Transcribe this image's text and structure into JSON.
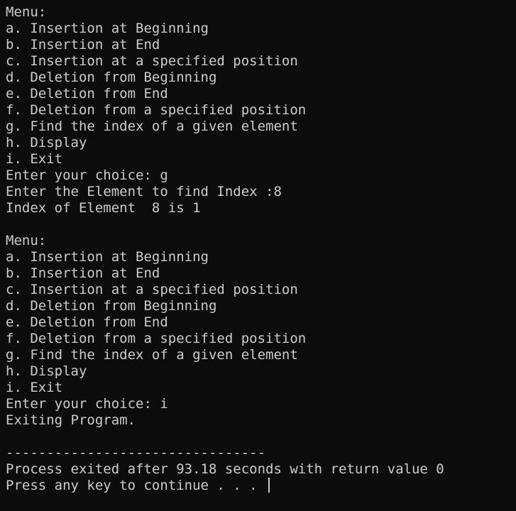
{
  "menu_block_1": {
    "heading": "Menu:",
    "items": [
      "a. Insertion at Beginning",
      "b. Insertion at End",
      "c. Insertion at a specified position",
      "d. Deletion from Beginning",
      "e. Deletion from End",
      "f. Deletion from a specified position",
      "g. Find the index of a given element",
      "h. Display",
      "i. Exit"
    ],
    "choice_prompt": "Enter your choice: g",
    "find_prompt": "Enter the Element to find Index :8",
    "find_result": "Index of Element  8 is 1"
  },
  "menu_block_2": {
    "heading": "Menu:",
    "items": [
      "a. Insertion at Beginning",
      "b. Insertion at End",
      "c. Insertion at a specified position",
      "d. Deletion from Beginning",
      "e. Deletion from End",
      "f. Deletion from a specified position",
      "g. Find the index of a given element",
      "h. Display",
      "i. Exit"
    ],
    "choice_prompt": "Enter your choice: i",
    "exit_message": "Exiting Program."
  },
  "footer": {
    "separator": "--------------------------------",
    "process_status": "Process exited after 93.18 seconds with return value 0",
    "continue_prompt": "Press any key to continue . . . "
  },
  "colors": {
    "background": "#0c0c0c",
    "text": "#cccccc"
  }
}
